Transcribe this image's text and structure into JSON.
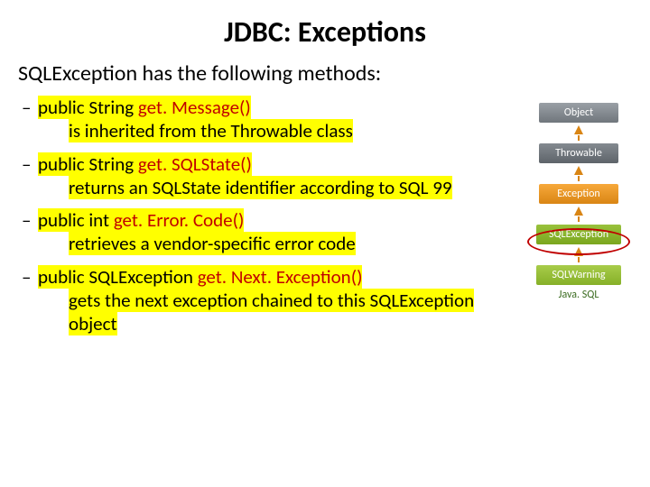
{
  "title": "JDBC: Exceptions",
  "subtitle": "SQLException has the following methods:",
  "methods": [
    {
      "sig_prefix": "public String ",
      "name": "get. Message()",
      "desc": "is inherited from the Throwable class"
    },
    {
      "sig_prefix": "public String ",
      "name": "get. SQLState()",
      "desc": "returns an SQLState identifier according to SQL 99"
    },
    {
      "sig_prefix": "public int ",
      "name": "get. Error. Code()",
      "desc": "retrieves a vendor-specific error code"
    },
    {
      "sig_prefix": "public SQLException ",
      "name": "get. Next. Exception()",
      "desc": "gets the next exception chained to this SQLException object"
    }
  ],
  "diagram": {
    "nodes": [
      "Object",
      "Throwable",
      "Exception",
      "SQLException",
      "SQLWarning"
    ],
    "caption": "Java. SQL"
  }
}
